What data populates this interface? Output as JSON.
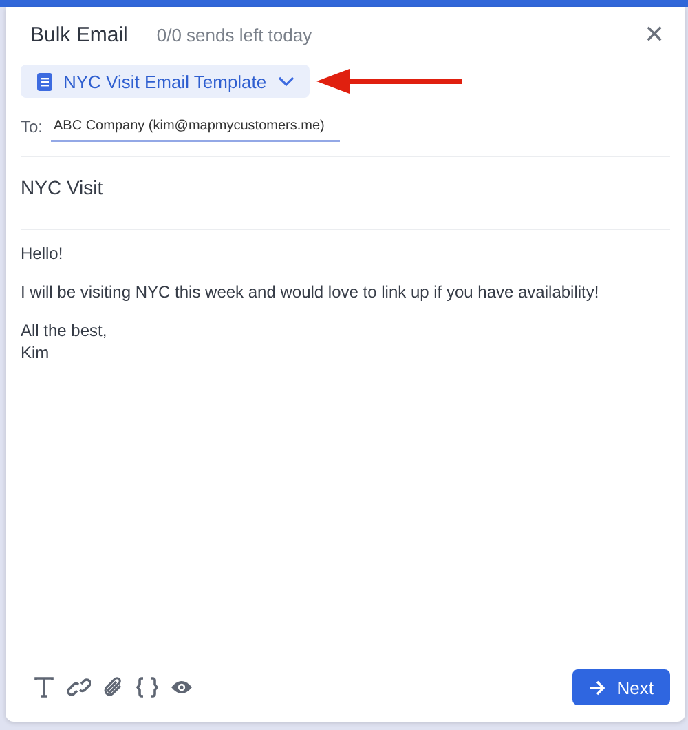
{
  "modal": {
    "title": "Bulk Email",
    "sends_left": "0/0 sends left today",
    "close": "✕"
  },
  "template": {
    "label": "NYC Visit Email Template"
  },
  "to": {
    "label": "To:",
    "value": "ABC Company (kim@mapmycustomers.me)"
  },
  "subject": "NYC Visit",
  "body": [
    "Hello!",
    "I will be visiting NYC this week and would love to link up if you have availability!",
    "All the best,\nKim"
  ],
  "toolbar": [
    {
      "kind": "text"
    },
    {
      "kind": "link"
    },
    {
      "kind": "attach"
    },
    {
      "kind": "variables"
    },
    {
      "kind": "preview"
    }
  ],
  "next_button": "Next"
}
